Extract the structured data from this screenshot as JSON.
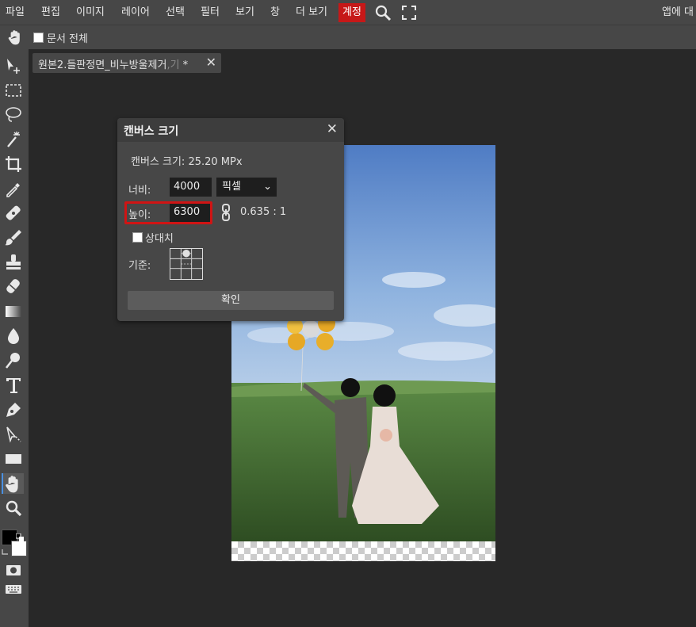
{
  "menubar": {
    "items": [
      "파일",
      "편집",
      "이미지",
      "레이어",
      "선택",
      "필터",
      "보기",
      "창",
      "더 보기"
    ],
    "account": "계정",
    "right_text": "앱에 대"
  },
  "optionsbar": {
    "whole_document": "문서 전체"
  },
  "doc_tab": {
    "title": "원본2.들판정면_비누방울제거",
    "title_tail": ",기",
    "modified": "*"
  },
  "dialog": {
    "title": "캔버스 크기",
    "canvas_size": "캔버스 크기: 25.20 MPx",
    "width_label": "너비:",
    "width_value": "4000",
    "unit": "픽셀",
    "height_label": "높이:",
    "height_value": "6300",
    "ratio": "0.635 : 1",
    "relative_label": "상대치",
    "anchor_label": "기준:",
    "ok": "확인"
  },
  "colors": {
    "accent": "#c61818",
    "highlight": "#d01414",
    "ui_bg": "#474747",
    "workspace": "#282828"
  }
}
